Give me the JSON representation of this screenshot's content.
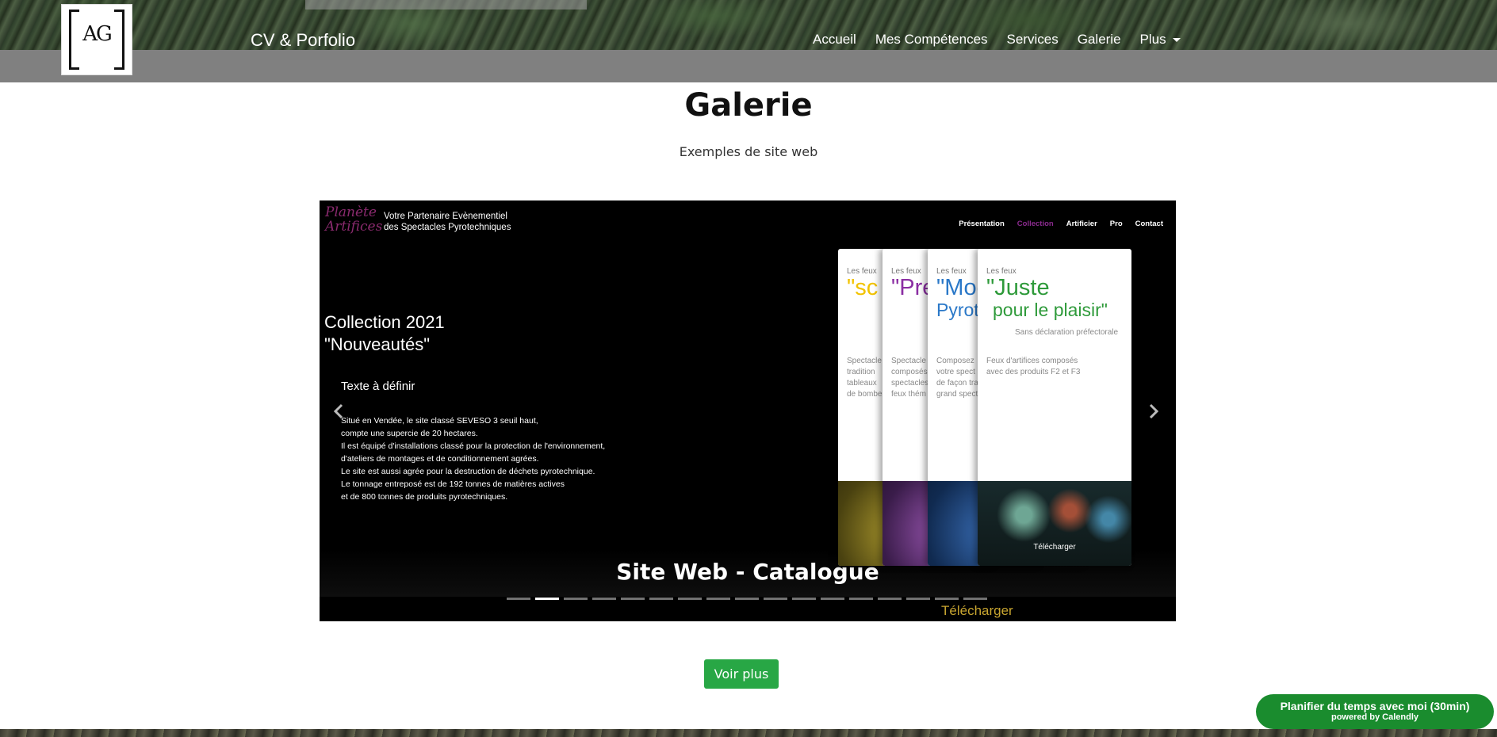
{
  "header": {
    "logo_text": "AG",
    "brand": "CV & Porfolio",
    "nav": [
      "Accueil",
      "Mes Compétences",
      "Services",
      "Galerie",
      "Plus"
    ]
  },
  "section": {
    "title": "Galerie",
    "subtitle": "Exemples de site web"
  },
  "carousel": {
    "slide": {
      "site_logo": "Planète Artifices",
      "tagline_line1": "Votre Partenaire Evènementiel",
      "tagline_line2": "des Spectacles Pyrotechniques",
      "site_nav": [
        "Présentation",
        "Collection",
        "Artificier",
        "Pro",
        "Contact"
      ],
      "heading_line1": "Collection 2021",
      "heading_line2": "\"Nouveautés\"",
      "subheading": "Texte à définir",
      "body": [
        "Situé en Vendée, le site classé SEVESO 3 seuil haut,",
        "compte une supercie de 20 hectares.",
        "Il est équipé d'installations classé pour la protection de l'environnement,",
        "d'ateliers de montages et de conditionnement agrées.",
        "Le site est aussi agrée pour la destruction de déchets pyrotechnique.",
        "Le tonnage entreposé est de 192 tonnes de matières actives",
        "et de 800 tonnes de produits pyrotechniques."
      ],
      "cards": [
        {
          "kicker": "Les feux",
          "headline": "\"sc",
          "desc": [
            "Spectacle",
            "tradition",
            "tableaux",
            "de bombe"
          ]
        },
        {
          "kicker": "Les feux",
          "headline": "\"Pre",
          "desc": [
            "Spectacle",
            "composés",
            "spectacles",
            "feux thém"
          ]
        },
        {
          "kicker": "Les feux",
          "headline": "\"Mod",
          "subline": "Pyrot",
          "desc": [
            "Composez",
            "votre spect",
            "de façon tra",
            "grand spect"
          ]
        },
        {
          "kicker": "Les feux",
          "headline": "\"Juste",
          "subline": "pour le plaisir\"",
          "note": "Sans déclaration préfectorale",
          "desc": [
            "Feux d'artifices composés",
            "avec des produits F2 et F3"
          ],
          "photo_label": "Télécharger"
        }
      ]
    },
    "caption": "Site Web - Catalogue",
    "download_label": "Télécharger",
    "slide_count": 17,
    "active_index": 1
  },
  "actions": {
    "more_label": "Voir plus"
  },
  "calendly": {
    "main": "Planifier du temps avec moi (30min)",
    "sub": "powered by Calendly"
  },
  "colors": {
    "header_gray": "#808080",
    "button_green": "#28a745",
    "calendly_green": "#1a8c2e",
    "download_gold": "#c8a530",
    "site_accent": "#8a2a8e"
  }
}
